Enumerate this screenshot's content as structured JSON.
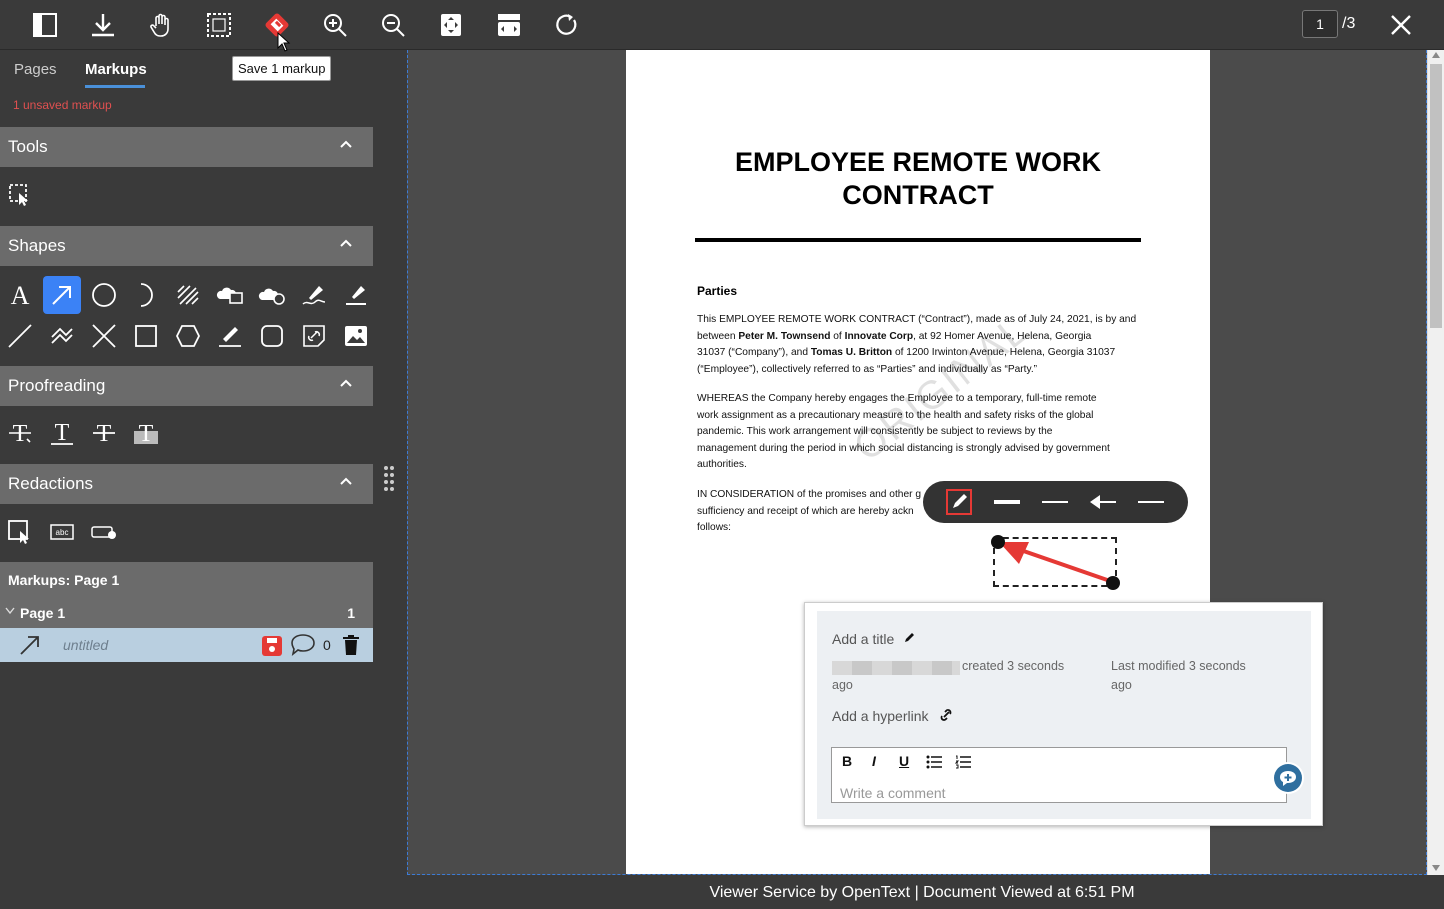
{
  "toolbar": {
    "tooltip": "Save 1 markup",
    "page_current": "1",
    "page_total": "/3"
  },
  "sidebar": {
    "tabs": [
      {
        "label": "Pages",
        "active": false
      },
      {
        "label": "Markups",
        "active": true
      }
    ],
    "unsaved_text": "1 unsaved markup",
    "sections": {
      "tools": "Tools",
      "shapes": "Shapes",
      "proofreading": "Proofreading",
      "redactions": "Redactions"
    },
    "markups_header": "Markups: Page 1",
    "page_group": {
      "label": "Page 1",
      "count": "1"
    },
    "markup_item": {
      "name": "untitled",
      "comment_count": "0"
    }
  },
  "document": {
    "title_line1": "EMPLOYEE REMOTE WORK",
    "title_line2": "CONTRACT",
    "section_heading": "Parties",
    "p1_a": "This EMPLOYEE REMOTE WORK CONTRACT (“Contract”), made as of July 24, 2021, is by and",
    "p1_b_pre": "between ",
    "p1_b_name1": "Peter M. Townsend",
    "p1_b_mid": " of ",
    "p1_b_corp": "Innovate Corp",
    "p1_b_post": ", at 92 Homer Avenue, Helena, Georgia",
    "p1_c_pre": "31037 (“Company”), and ",
    "p1_c_name2": "Tomas U. Britton",
    "p1_c_post": " of 1200 Irwinton Avenue, Helena, Georgia 31037",
    "p1_d": "(“Employee”), collectively referred to as “Parties” and individually as “Party.”",
    "p2_a": "WHEREAS the Company hereby engages the Employee to a temporary, full-time remote",
    "p2_b": "work assignment as a precautionary measure to the health and safety risks of the global",
    "p2_c": "pandemic. This work arrangement will consistently be subject to reviews by the",
    "p2_d": "management during the period in which social distancing is strongly advised by government",
    "p2_e": "authorities.",
    "p3_a": "IN CONSIDERATION of the promises and other g",
    "p3_b": "sufficiency and receipt of which are hereby ackn",
    "p3_c": "follows:",
    "watermark": "ORIGINAL"
  },
  "comment_popup": {
    "title_placeholder": "Add a title",
    "created": "created 3 seconds",
    "created_ago": "ago",
    "modified": "Last modified 3 seconds",
    "modified_ago": "ago",
    "hyperlink": "Add a hyperlink",
    "bold": "B",
    "italic": "I",
    "underline": "U",
    "comment_placeholder": "Write a comment"
  },
  "footer": "Viewer Service by OpenText | Document Viewed at 6:51 PM",
  "colors": {
    "accent": "#3b82f6",
    "danger": "#e53935",
    "unsaved": "#e05050"
  }
}
